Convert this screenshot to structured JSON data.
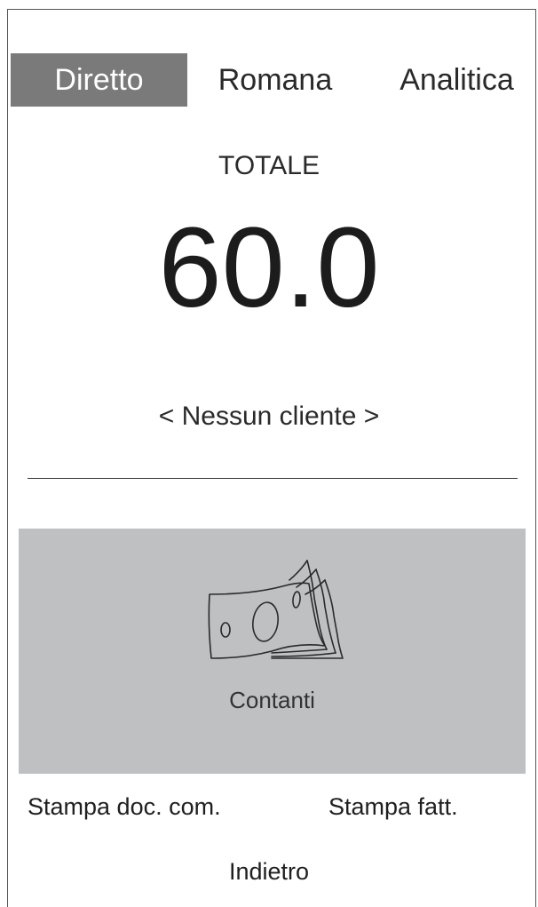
{
  "tabs": [
    {
      "label": "Diretto",
      "active": true
    },
    {
      "label": "Romana",
      "active": false
    },
    {
      "label": "Analitica",
      "active": false
    }
  ],
  "total": {
    "label": "TOTALE",
    "value": "60.0"
  },
  "customer": {
    "label": "< Nessun cliente >"
  },
  "payment": {
    "icon": "cash-banknotes-icon",
    "label": "Contanti"
  },
  "actions": {
    "print_doc": "Stampa doc. com.",
    "print_invoice": "Stampa fatt.",
    "back": "Indietro"
  },
  "colors": {
    "active_tab": "#7a7a7a",
    "payment_tile": "#bfc0c2"
  }
}
